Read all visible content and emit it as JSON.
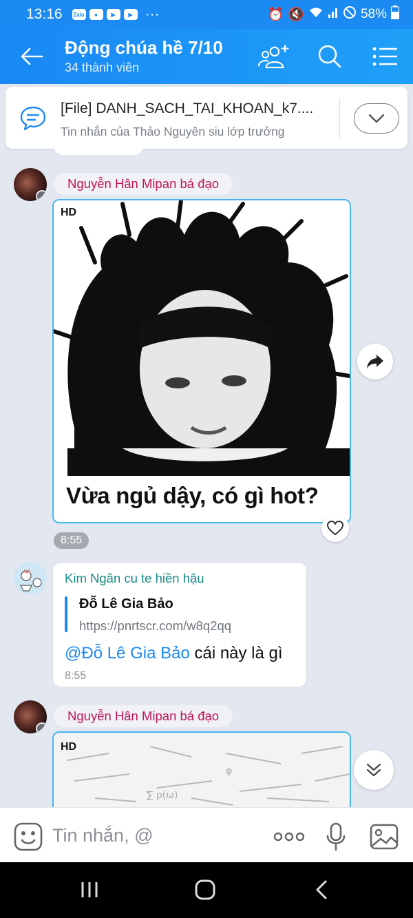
{
  "status_bar": {
    "time": "13:16",
    "apps": [
      "Zalo"
    ],
    "more": "···",
    "battery": "58%"
  },
  "header": {
    "title": "Động chúa hề 7/10",
    "subtitle": "34 thành viên"
  },
  "pinned": {
    "title": "[File] DANH_SACH_TAI_KHOAN_k7....",
    "subtitle": "Tin nhắn của Thảo Nguyên siu lớp trưởng"
  },
  "messages": [
    {
      "sender": "Nguyễn Hân Mipan bá đạo",
      "type": "image",
      "badge": "HD",
      "caption": "Vừa ngủ dậy, có gì hot?",
      "time": "8:55"
    },
    {
      "sender": "Kim Ngân cu te hiền hậu",
      "type": "text",
      "quote_name": "Đỗ Lê Gia Bảo",
      "quote_link": "https://pnrtscr.com/w8q2qq",
      "mention": "@Đỗ Lê Gia Bảo",
      "text": " cái này là gì",
      "time": "8:55"
    },
    {
      "sender": "Nguyễn Hân Mipan bá đạo",
      "type": "image",
      "badge": "HD"
    }
  ],
  "input": {
    "placeholder": "Tin nhắn, @"
  },
  "colors": {
    "header_blue": "#1b8af2",
    "sender_red": "#c0165a",
    "sender_teal": "#168a87",
    "mention_blue": "#1b8af2"
  }
}
